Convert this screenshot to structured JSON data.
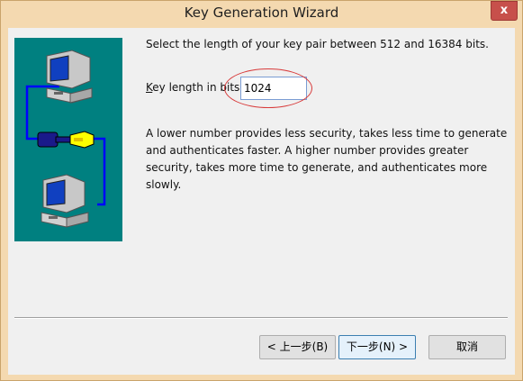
{
  "window": {
    "title": "Key Generation Wizard",
    "close_label": "x"
  },
  "content": {
    "prompt": "Select the length of your key pair between 512 and 16384 bits.",
    "key_length_label_prefix": "K",
    "key_length_label_rest": "ey length in bits:",
    "key_length_value": "1024",
    "description": "A lower number provides less security, takes less time to generate and authenticates faster. A higher number provides greater security, takes more time to generate, and authenticates more slowly."
  },
  "buttons": {
    "back": "< 上一步(B)",
    "next": "下一步(N) >",
    "cancel": "取消"
  },
  "colors": {
    "art_background": "#008080",
    "highlight_oval": "#d83a3a",
    "title_bar": "#f4d9b0"
  },
  "icons": {
    "top": "computer-icon",
    "middle": "key-icon",
    "bottom": "computer-icon"
  }
}
